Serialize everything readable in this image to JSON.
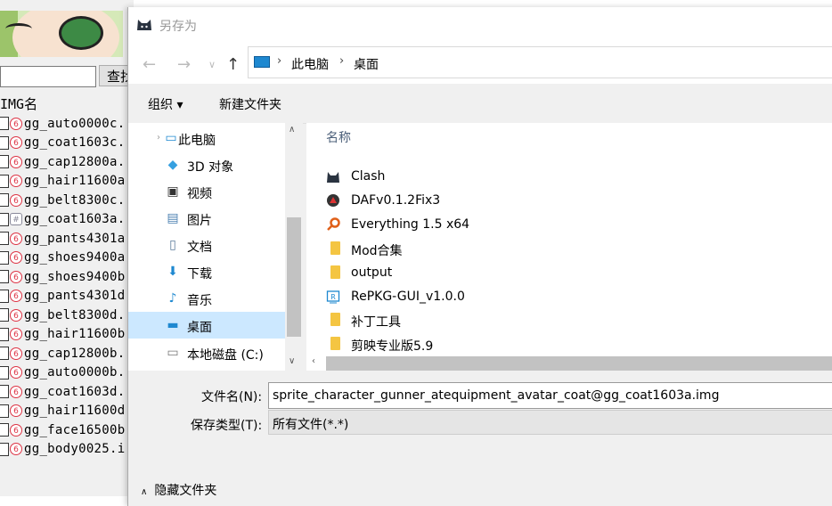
{
  "background_app": {
    "search_button": "查找",
    "column_header": "IMG名",
    "files": [
      {
        "name": "gg_auto0000c.",
        "icon": "red-circle-icon"
      },
      {
        "name": "gg_coat1603c.",
        "icon": "red-circle-icon"
      },
      {
        "name": "gg_cap12800a.",
        "icon": "red-circle-icon"
      },
      {
        "name": "gg_hair11600a",
        "icon": "red-circle-icon"
      },
      {
        "name": "gg_belt8300c.",
        "icon": "red-circle-icon"
      },
      {
        "name": "gg_coat1603a.",
        "icon": "grid-icon"
      },
      {
        "name": "gg_pants4301a",
        "icon": "red-circle-icon"
      },
      {
        "name": "gg_shoes9400a",
        "icon": "red-circle-icon"
      },
      {
        "name": "gg_shoes9400b",
        "icon": "red-circle-icon"
      },
      {
        "name": "gg_pants4301d",
        "icon": "red-circle-icon"
      },
      {
        "name": "gg_belt8300d.",
        "icon": "red-circle-icon"
      },
      {
        "name": "gg_hair11600b",
        "icon": "red-circle-icon"
      },
      {
        "name": "gg_cap12800b.",
        "icon": "red-circle-icon"
      },
      {
        "name": "gg_auto0000b.",
        "icon": "red-circle-icon"
      },
      {
        "name": "gg_coat1603d.",
        "icon": "red-circle-icon"
      },
      {
        "name": "gg_hair11600d",
        "icon": "red-circle-icon"
      },
      {
        "name": "gg_face16500b",
        "icon": "red-circle-icon"
      },
      {
        "name": "gg_body0025.i",
        "icon": "red-circle-icon"
      }
    ]
  },
  "dialog": {
    "title": "另存为",
    "address": {
      "crumbs": [
        "此电脑",
        "桌面"
      ]
    },
    "toolbar": {
      "organize": "组织 ▾",
      "new_folder": "新建文件夹"
    },
    "nav_items": [
      {
        "label": "此电脑",
        "icon": "computer-icon"
      },
      {
        "label": "3D 对象",
        "icon": "cube-icon"
      },
      {
        "label": "视频",
        "icon": "video-icon"
      },
      {
        "label": "图片",
        "icon": "picture-icon"
      },
      {
        "label": "文档",
        "icon": "document-icon"
      },
      {
        "label": "下载",
        "icon": "download-icon"
      },
      {
        "label": "音乐",
        "icon": "music-icon"
      },
      {
        "label": "桌面",
        "icon": "desktop-icon",
        "selected": true
      },
      {
        "label": "本地磁盘 (C:)",
        "icon": "drive-icon"
      }
    ],
    "file_list": {
      "header": "名称",
      "items": [
        {
          "name": "Clash",
          "icon": "cat-icon"
        },
        {
          "name": "DAFv0.1.2Fix3",
          "icon": "app-icon"
        },
        {
          "name": "Everything 1.5 x64",
          "icon": "search-icon"
        },
        {
          "name": "Mod合集",
          "icon": "folder-icon"
        },
        {
          "name": "output",
          "icon": "folder-icon"
        },
        {
          "name": "RePKG-GUI_v1.0.0",
          "icon": "app-icon"
        },
        {
          "name": "补丁工具",
          "icon": "folder-icon"
        },
        {
          "name": "剪映专业版5.9",
          "icon": "folder-icon"
        }
      ]
    },
    "filename_label": "文件名(N):",
    "filename_value": "sprite_character_gunner_atequipment_avatar_coat@gg_coat1603a.img",
    "filetype_label": "保存类型(T):",
    "filetype_value": "所有文件(*.*)",
    "hide_folders": "隐藏文件夹"
  }
}
